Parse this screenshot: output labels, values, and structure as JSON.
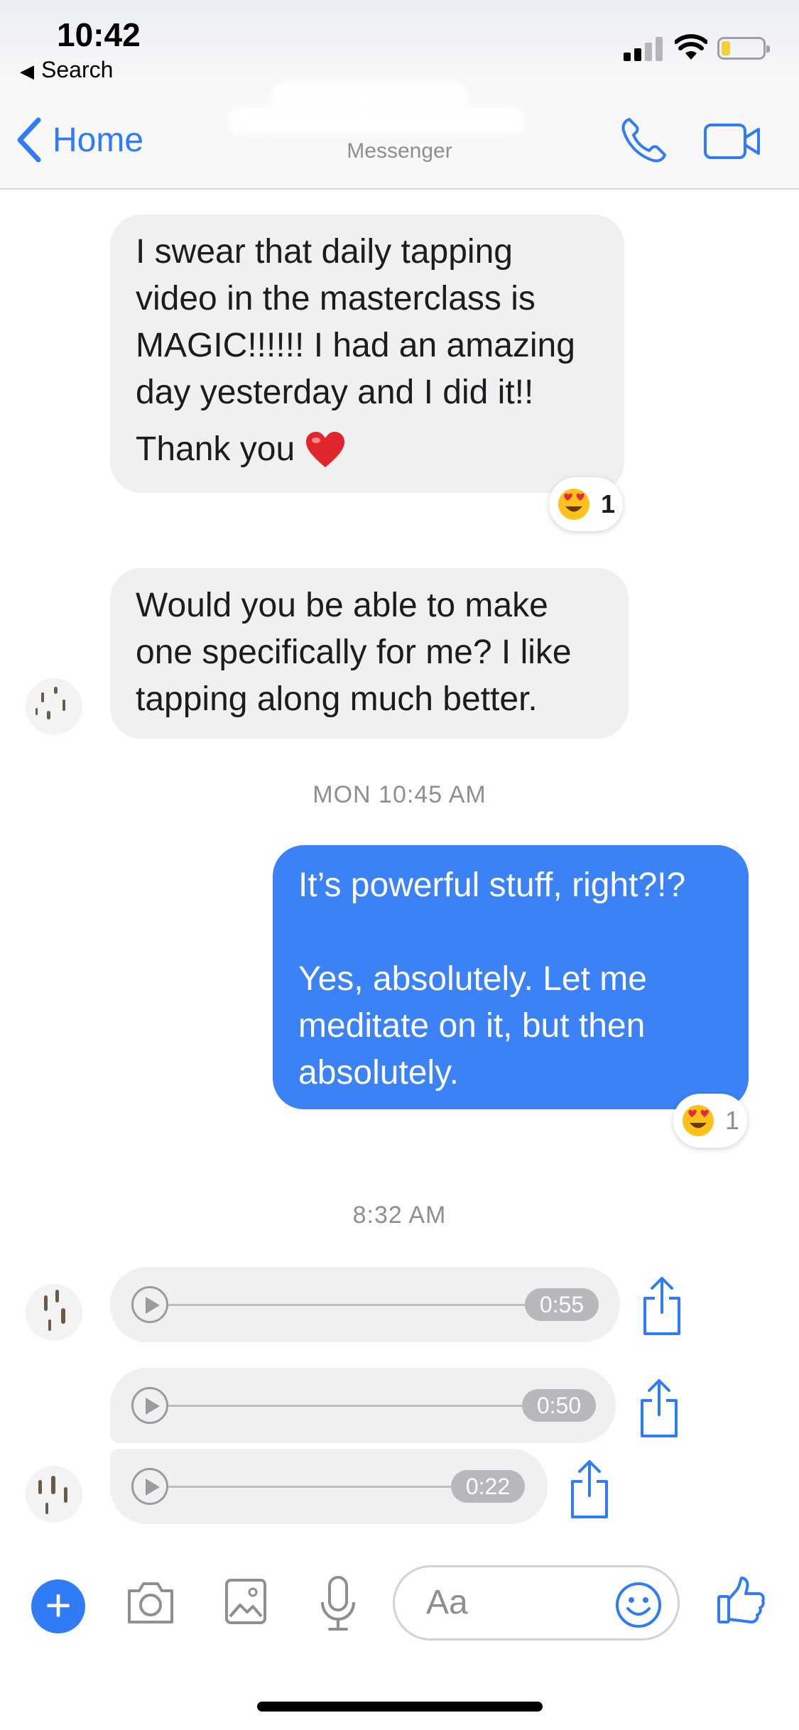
{
  "status_bar": {
    "time": "10:42",
    "back_label": "Search"
  },
  "header": {
    "back_label": "Home",
    "subtitle": "Messenger",
    "accent_color": "#2f7cf6"
  },
  "messages": [
    {
      "type": "incoming",
      "lines": [
        "I swear that daily tapping",
        "video in the masterclass is",
        "MAGIC!!!!!! I had an amazing",
        "day yesterday and I did it!!"
      ],
      "last_line": "Thank you",
      "emoji": "red-heart",
      "reaction": {
        "emoji": "heart-eyes",
        "count": "1"
      }
    },
    {
      "type": "incoming",
      "lines": [
        "Would you be able to make",
        "one specifically for me? I like",
        "tapping along much better."
      ]
    },
    {
      "type": "timestamp",
      "text": "MON 10:45 AM"
    },
    {
      "type": "outgoing",
      "lines": [
        "It’s powerful stuff, right?!?",
        "",
        "Yes, absolutely. Let me",
        "meditate on it, but then",
        "absolutely."
      ],
      "reaction": {
        "emoji": "heart-eyes",
        "count": "1"
      }
    },
    {
      "type": "timestamp",
      "text": "8:32 AM"
    },
    {
      "type": "audio",
      "duration": "0:55"
    },
    {
      "type": "audio",
      "duration": "0:50"
    },
    {
      "type": "audio",
      "duration": "0:22"
    }
  ],
  "composer": {
    "placeholder": "Aa"
  },
  "colors": {
    "incoming_bubble": "#f0f0f0",
    "outgoing_bubble": "#3a82f6",
    "icon_blue": "#2f7cf6"
  }
}
